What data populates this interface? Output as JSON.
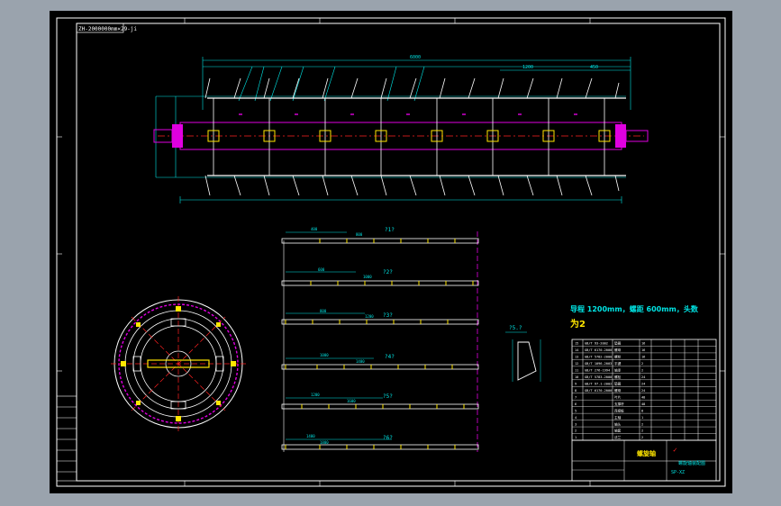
{
  "drawing": {
    "stamp": "ZH-2000000mm×29-ji",
    "note_line1": "导程 1200mm，螺距 600mm，头数",
    "note_line2": "为2",
    "section_label": "?5.?",
    "rows": [
      {
        "label": "?1?",
        "dim_a": "400",
        "dim_b": "800"
      },
      {
        "label": "?2?",
        "dim_a": "600",
        "dim_b": "1000"
      },
      {
        "label": "?3?",
        "dim_a": "800",
        "dim_b": "1200"
      },
      {
        "label": "?4?",
        "dim_a": "1000",
        "dim_b": "1400"
      },
      {
        "label": "?5?",
        "dim_a": "1200",
        "dim_b": "1600"
      },
      {
        "label": "?6?",
        "dim_a": "1400",
        "dim_b": "1800"
      }
    ],
    "top_dims": {
      "overall": "6000",
      "pitch": "1200",
      "end": "450"
    },
    "title_block": {
      "name": "螺旋轴",
      "drawing_no": "螺旋轴装配图",
      "sheet": "SP-XZ"
    },
    "parts_table": [
      [
        "15",
        "GB/T 93-2002",
        "垫圈",
        "16",
        "",
        "",
        ""
      ],
      [
        "14",
        "GB/T 6170-2000",
        "螺母",
        "16",
        "",
        "",
        ""
      ],
      [
        "13",
        "GB/T 5782-2000",
        "螺栓",
        "16",
        "",
        "",
        ""
      ],
      [
        "12",
        "GB/T 1096-2003",
        "平键",
        "2",
        "",
        "",
        ""
      ],
      [
        "11",
        "GB/T 276-1994",
        "轴承",
        "2",
        "",
        "",
        ""
      ],
      [
        "10",
        "GB/T 5783-2000",
        "螺栓",
        "24",
        "",
        "",
        ""
      ],
      [
        "9",
        "GB/T 97.1-2002",
        "垫圈",
        "24",
        "",
        "",
        ""
      ],
      [
        "8",
        "GB/T 6170-2000",
        "螺母",
        "24",
        "",
        "",
        ""
      ],
      [
        "7",
        "",
        "叶片",
        "48",
        "",
        "",
        ""
      ],
      [
        "6",
        "",
        "支撑杆",
        "48",
        "",
        "",
        ""
      ],
      [
        "5",
        "",
        "连接板",
        "8",
        "",
        "",
        ""
      ],
      [
        "4",
        "",
        "主轴",
        "1",
        "",
        "",
        ""
      ],
      [
        "3",
        "",
        "轴头",
        "2",
        "",
        "",
        ""
      ],
      [
        "2",
        "",
        "轴套",
        "2",
        "",
        "",
        ""
      ],
      [
        "1",
        "",
        "法兰",
        "2",
        "",
        "",
        ""
      ]
    ]
  },
  "colors": {
    "background": "#000000",
    "frame": "#ffffff",
    "cyan": "#00e5e5",
    "magenta": "#e000e0",
    "red": "#ff2020",
    "yellow": "#ffe600"
  }
}
